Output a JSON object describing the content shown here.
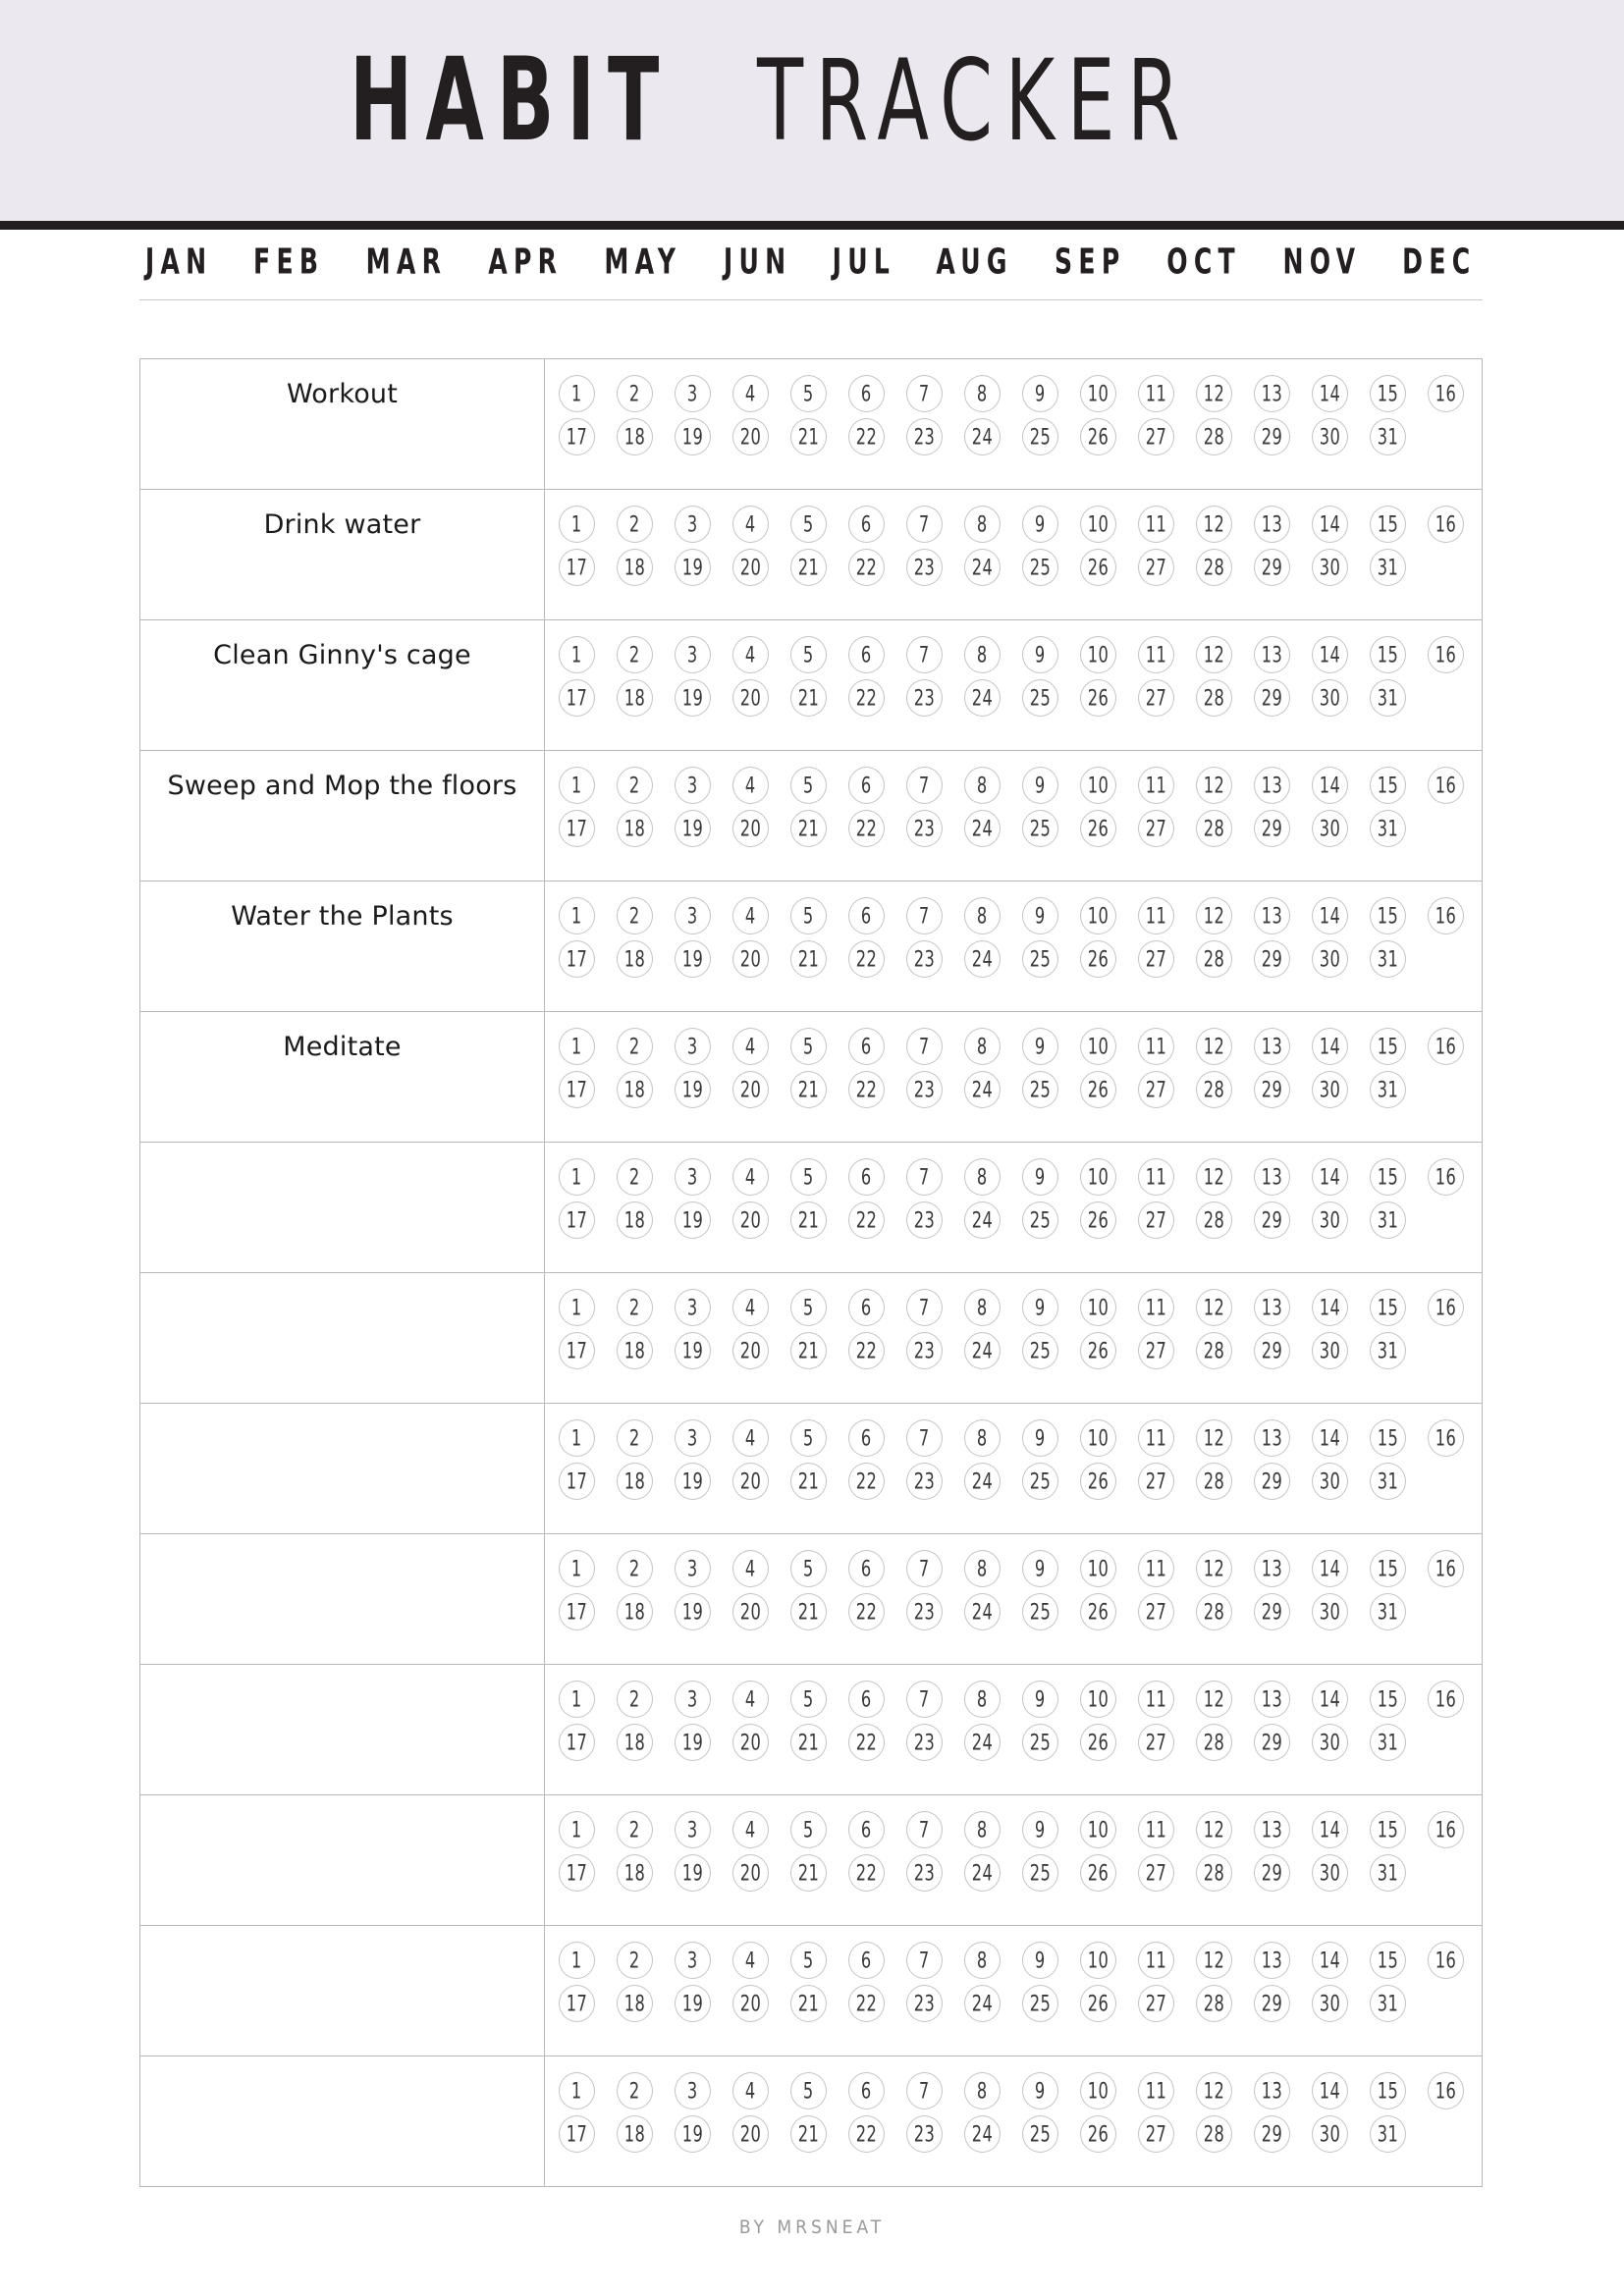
{
  "header": {
    "title_bold": "HABIT",
    "title_light": "TRACKER",
    "background_color": "#ECE8F0",
    "rule_color": "#231F20"
  },
  "months": {
    "items": [
      {
        "label": "JAN"
      },
      {
        "label": "FEB"
      },
      {
        "label": "MAR"
      },
      {
        "label": "APR"
      },
      {
        "label": "MAY"
      },
      {
        "label": "JUN"
      },
      {
        "label": "JUL"
      },
      {
        "label": "AUG"
      },
      {
        "label": "SEP"
      },
      {
        "label": "OCT"
      },
      {
        "label": "NOV"
      },
      {
        "label": "DEC"
      }
    ]
  },
  "tracker": {
    "days_row_one": [
      "1",
      "2",
      "3",
      "4",
      "5",
      "6",
      "7",
      "8",
      "9",
      "10",
      "11",
      "12",
      "13",
      "14",
      "15",
      "16"
    ],
    "days_row_two": [
      "17",
      "18",
      "19",
      "20",
      "21",
      "22",
      "23",
      "24",
      "25",
      "26",
      "27",
      "28",
      "29",
      "30",
      "31"
    ],
    "border_color": "#B9B9B9",
    "circle_border_color": "#C4C4C4",
    "rows": [
      {
        "habit": "Workout"
      },
      {
        "habit": "Drink water"
      },
      {
        "habit": "Clean Ginny's cage"
      },
      {
        "habit": "Sweep and Mop the floors"
      },
      {
        "habit": "Water the Plants"
      },
      {
        "habit": "Meditate"
      },
      {
        "habit": ""
      },
      {
        "habit": ""
      },
      {
        "habit": ""
      },
      {
        "habit": ""
      },
      {
        "habit": ""
      },
      {
        "habit": ""
      },
      {
        "habit": ""
      },
      {
        "habit": ""
      }
    ]
  },
  "footer": {
    "credit": "BY MRSNEAT"
  }
}
